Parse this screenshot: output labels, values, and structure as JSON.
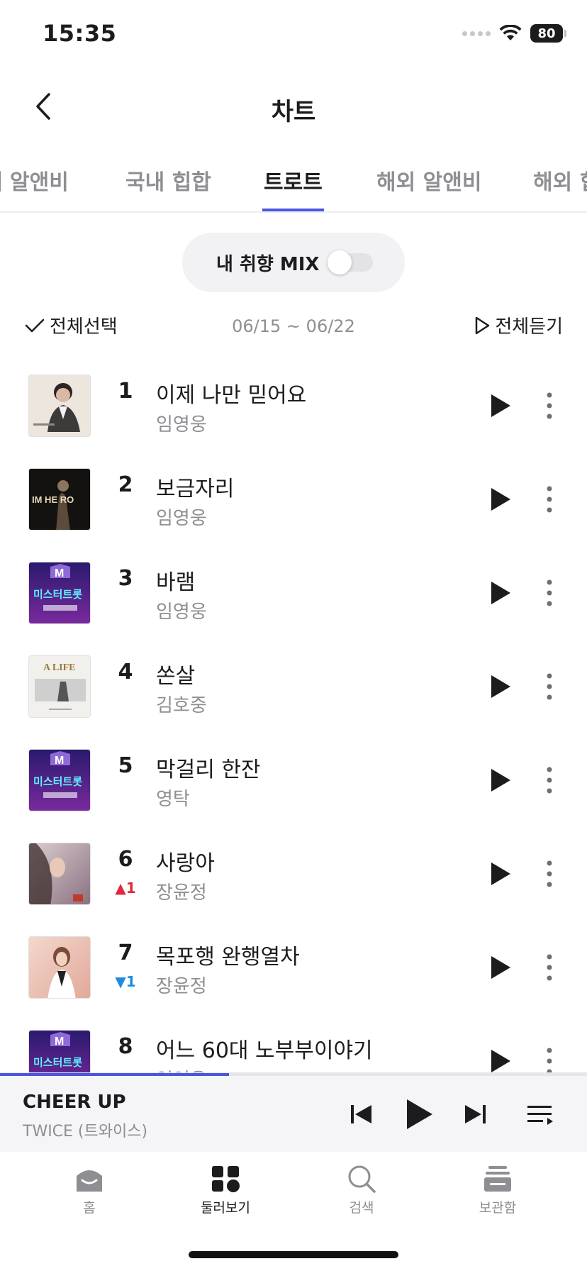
{
  "status_bar": {
    "time": "15:35",
    "battery": "80"
  },
  "header": {
    "title": "차트"
  },
  "tabs": [
    {
      "label": "내 알앤비",
      "active": false
    },
    {
      "label": "국내 힙합",
      "active": false
    },
    {
      "label": "트로트",
      "active": true
    },
    {
      "label": "해외 알앤비",
      "active": false
    },
    {
      "label": "해외 힙",
      "active": false
    }
  ],
  "mix": {
    "label": "내 취향 MIX",
    "enabled": false
  },
  "controls": {
    "select_all": "전체선택",
    "date_range": "06/15 ~ 06/22",
    "play_all": "전체듣기"
  },
  "songs": [
    {
      "rank": "1",
      "title": "이제 나만 믿어요",
      "artist": "임영웅",
      "change": ""
    },
    {
      "rank": "2",
      "title": "보금자리",
      "artist": "임영웅",
      "change": "",
      "cover_text": "IM HE RO"
    },
    {
      "rank": "3",
      "title": "바램",
      "artist": "임영웅",
      "change": "",
      "cover_text": "미스터트롯"
    },
    {
      "rank": "4",
      "title": "쏜살",
      "artist": "김호중",
      "change": "",
      "cover_text": "A LIFE"
    },
    {
      "rank": "5",
      "title": "막걸리 한잔",
      "artist": "영탁",
      "change": "",
      "cover_text": "미스터트롯"
    },
    {
      "rank": "6",
      "title": "사랑아",
      "artist": "장윤정",
      "change": "▲1",
      "change_dir": "up"
    },
    {
      "rank": "7",
      "title": "목포행 완행열차",
      "artist": "장윤정",
      "change": "▼1",
      "change_dir": "down"
    },
    {
      "rank": "8",
      "title": "어느 60대 노부부이야기",
      "artist": "임영웅",
      "change": "",
      "cover_text": "미스터트롯"
    }
  ],
  "now_playing": {
    "title": "CHEER UP",
    "artist": "TWICE (트와이스)",
    "progress": 0.39
  },
  "bottom_nav": [
    {
      "label": "홈",
      "icon": "home-icon",
      "active": false
    },
    {
      "label": "둘러보기",
      "icon": "browse-icon",
      "active": true
    },
    {
      "label": "검색",
      "icon": "search-icon",
      "active": false
    },
    {
      "label": "보관함",
      "icon": "library-icon",
      "active": false
    }
  ],
  "colors": {
    "accent": "#4a55e0",
    "up": "#e0283c",
    "down": "#1e8be0"
  }
}
